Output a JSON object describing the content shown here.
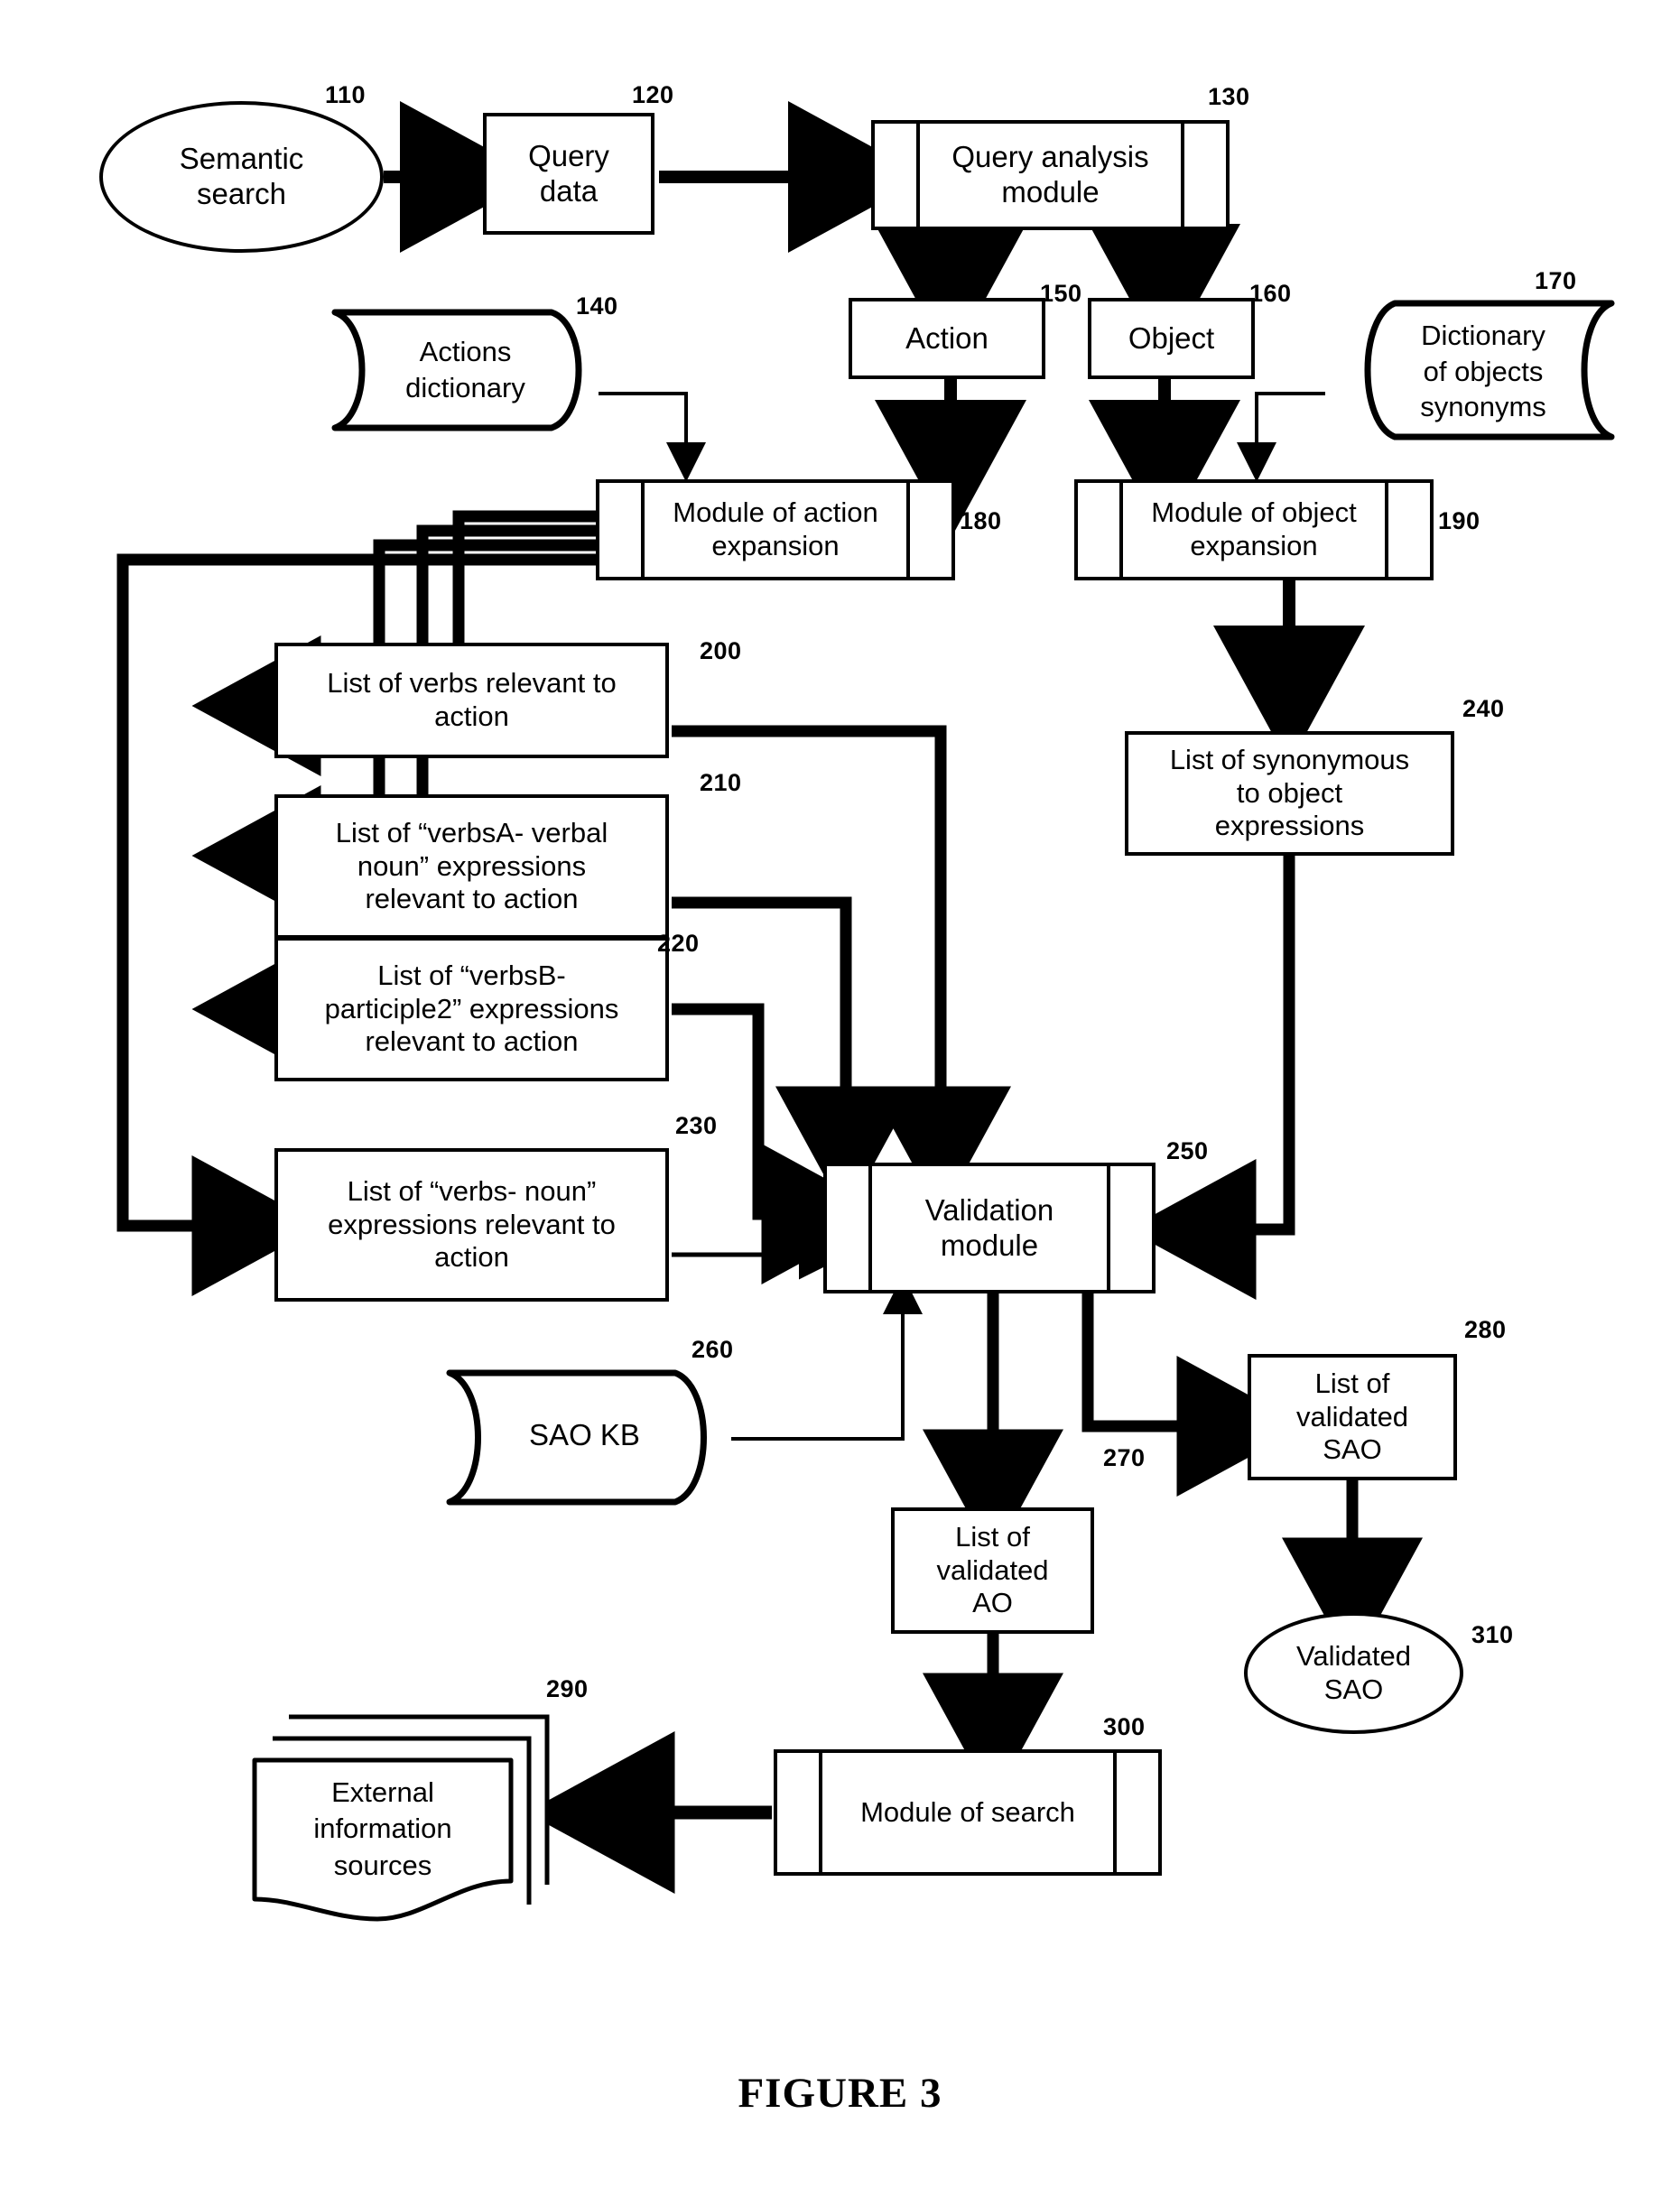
{
  "figure": {
    "caption": "FIGURE 3"
  },
  "nodes": [
    {
      "id": "semantic-search",
      "ref": "110",
      "label": "Semantic\nsearch",
      "shape": "ellipse"
    },
    {
      "id": "query-data",
      "ref": "120",
      "label": "Query\ndata",
      "shape": "rect"
    },
    {
      "id": "query-analysis-module",
      "ref": "130",
      "label": "Query analysis\nmodule",
      "shape": "module"
    },
    {
      "id": "actions-dictionary",
      "ref": "140",
      "label": "Actions\ndictionary",
      "shape": "database-right"
    },
    {
      "id": "action",
      "ref": "150",
      "label": "Action",
      "shape": "rect"
    },
    {
      "id": "object",
      "ref": "160",
      "label": "Object",
      "shape": "rect"
    },
    {
      "id": "dictionary-of-objects-synonyms",
      "ref": "170",
      "label": "Dictionary\nof objects\nsynonyms",
      "shape": "database-left"
    },
    {
      "id": "module-of-action-expansion",
      "ref": "180",
      "label": "Module of action\nexpansion",
      "shape": "module"
    },
    {
      "id": "module-of-object-expansion",
      "ref": "190",
      "label": "Module of object\nexpansion",
      "shape": "module"
    },
    {
      "id": "list-verbs-relevant",
      "ref": "200",
      "label": "List of verbs relevant to\naction",
      "shape": "rect"
    },
    {
      "id": "list-verbsa-verbal-noun",
      "ref": "210",
      "label": "List of “verbsA- verbal\nnoun” expressions\nrelevant to action",
      "shape": "rect"
    },
    {
      "id": "list-verbsb-participle2",
      "ref": "220",
      "label": "List of “verbsB-\nparticiple2” expressions\nrelevant to action",
      "shape": "rect"
    },
    {
      "id": "list-verbs-noun",
      "ref": "230",
      "label": "List of “verbs- noun”\nexpressions relevant to\naction",
      "shape": "rect"
    },
    {
      "id": "list-synonymous-object",
      "ref": "240",
      "label": "List of synonymous\nto object\nexpressions",
      "shape": "rect"
    },
    {
      "id": "validation-module",
      "ref": "250",
      "label": "Validation\nmodule",
      "shape": "module"
    },
    {
      "id": "sao-kb",
      "ref": "260",
      "label": "SAO KB",
      "shape": "database-right"
    },
    {
      "id": "list-of-validated-ao",
      "ref": "270",
      "label": "List of\nvalidated\nAO",
      "shape": "rect"
    },
    {
      "id": "list-of-validated-sao",
      "ref": "280",
      "label": "List of\nvalidated\nSAO",
      "shape": "rect"
    },
    {
      "id": "external-information-sources",
      "ref": "290",
      "label": "External\ninformation\nsources",
      "shape": "documents"
    },
    {
      "id": "module-of-search",
      "ref": "300",
      "label": "Module of search",
      "shape": "module"
    },
    {
      "id": "validated-sao",
      "ref": "310",
      "label": "Validated\nSAO",
      "shape": "ellipse"
    }
  ],
  "colors": {
    "stroke": "#000000",
    "fill": "#ffffff"
  }
}
